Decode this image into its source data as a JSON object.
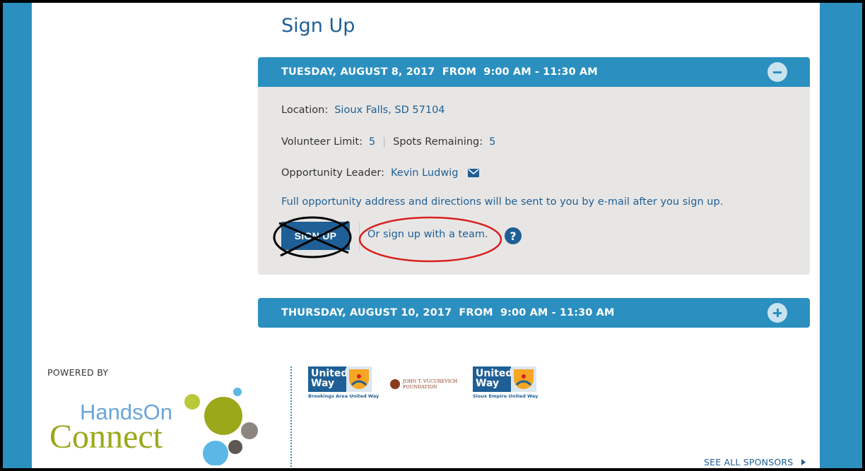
{
  "page": {
    "title": "Sign Up"
  },
  "sessions": [
    {
      "header": "TUESDAY, AUGUST 8, 2017  FROM  9:00 AM - 11:30 AM",
      "expanded": true,
      "location_label": "Location:",
      "location_value": "Sioux Falls, SD 57104",
      "limit_label": "Volunteer Limit:",
      "limit_value": "5",
      "remaining_label": "Spots Remaining:",
      "remaining_value": "5",
      "leader_label": "Opportunity Leader:",
      "leader_value": "Kevin Ludwig",
      "notice": "Full opportunity address and directions will be sent to you by e-mail after you sign up.",
      "signup_label": "SIGN UP",
      "team_link": "Or sign up with a team.",
      "help": "?"
    },
    {
      "header": "THURSDAY, AUGUST 10, 2017  FROM  9:00 AM - 11:30 AM",
      "expanded": false
    }
  ],
  "footer": {
    "powered_by": "POWERED BY",
    "logo_line1": "HandsOn",
    "logo_line2": "Connect",
    "sponsors": [
      {
        "name_line1": "United",
        "name_line2": "Way",
        "caption": "Brookings Area United Way"
      },
      {
        "name_line1": "JOHN T. VUCUREVICH",
        "name_line2": "FOUNDATION"
      },
      {
        "name_line1": "United",
        "name_line2": "Way",
        "caption": "Sioux Empire United Way"
      }
    ],
    "see_all": "SEE ALL SPONSORS"
  },
  "colors": {
    "accent": "#2b8fc0",
    "link": "#1f5f95",
    "panel": "#e8e6e4",
    "annotation_red": "#d9201f",
    "annotation_black": "#000000"
  }
}
